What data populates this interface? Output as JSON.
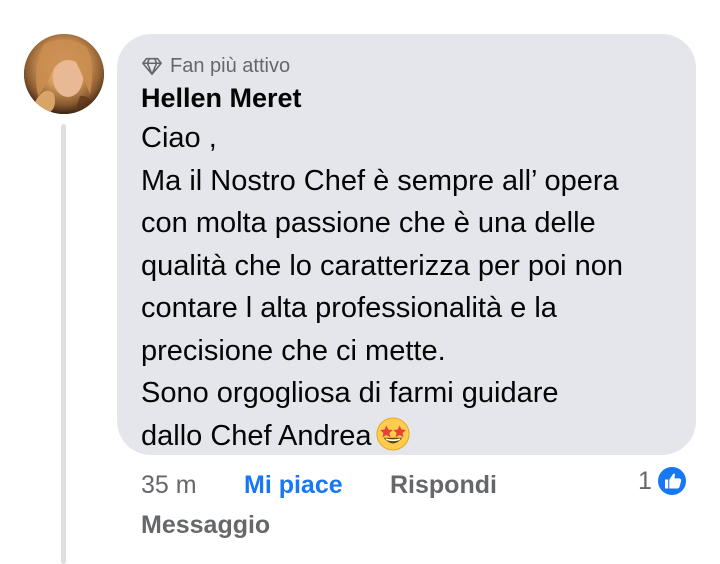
{
  "comment": {
    "badge_label": "Fan più attivo",
    "author": "Hellen Meret",
    "lines": [
      "Ciao ,",
      "Ma il Nostro Chef è sempre all’ opera",
      "con molta passione che è una delle",
      "qualità che lo caratterizza per poi non",
      "contare l alta professionalità e la",
      "precisione che ci mette.",
      "Sono orgogliosa di farmi guidare",
      "dallo Chef Andrea"
    ],
    "emoji": "star-struck-emoji"
  },
  "actions": {
    "time": "35 m",
    "like_label": "Mi piace",
    "reply_label": "Rispondi",
    "message_label": "Messaggio",
    "reaction_count": "1"
  },
  "colors": {
    "bubble": "#e4e6eb",
    "like_blue": "#1877f2",
    "secondary_text": "#65676b"
  }
}
